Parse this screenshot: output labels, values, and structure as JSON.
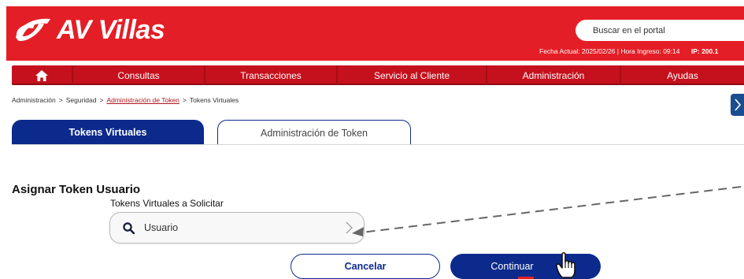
{
  "header": {
    "logo_text": "AV Villas",
    "search_placeholder": "Buscar en el portal",
    "date_info": "Fecha Actual: 2025/02/26 | Hora Ingreso: 09:14",
    "ip_label": "IP: 200.1",
    "brand_color": "#e41e26"
  },
  "nav": {
    "home_icon": "home-icon",
    "items": [
      "Consultas",
      "Transacciones",
      "Servicio al Cliente",
      "Administración",
      "Ayudas"
    ]
  },
  "breadcrumb": {
    "items": [
      "Administración",
      "Seguridad",
      "Administración de Token",
      "Tokens Virtuales"
    ],
    "separator": ">"
  },
  "tabs": {
    "active": "Tokens Virtuales",
    "inactive": "Administración de Token"
  },
  "form": {
    "title": "Asignar Token Usuario",
    "field_label": "Tokens Virtuales a Solicitar",
    "field_value": "Usuario"
  },
  "buttons": {
    "cancel": "Cancelar",
    "continue": "Continuar"
  },
  "colors": {
    "primary_blue": "#0b2a8c",
    "nav_red": "#c5111d"
  }
}
